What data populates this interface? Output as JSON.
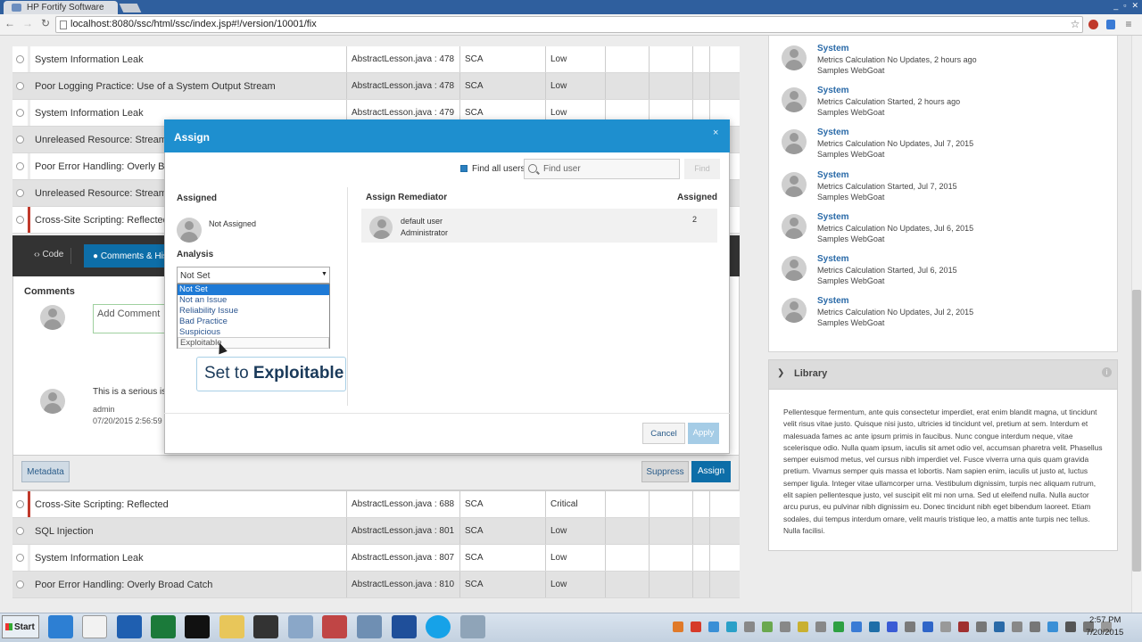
{
  "browser": {
    "tab_title": "HP Fortify Software",
    "url": "localhost:8080/ssc/html/ssc/index.jsp#!/version/10001/fix"
  },
  "issues_top": [
    {
      "category": "System Information Leak",
      "file": "AbstractLesson.java : 478",
      "analysis": "SCA",
      "severity": "Low",
      "sev_color": "#ececec"
    },
    {
      "category": "Poor Logging Practice: Use of a System Output Stream",
      "file": "AbstractLesson.java : 478",
      "analysis": "SCA",
      "severity": "Low",
      "sev_color": "#e2e2e2"
    },
    {
      "category": "System Information Leak",
      "file": "AbstractLesson.java : 479",
      "analysis": "SCA",
      "severity": "Low",
      "sev_color": "#ececec"
    },
    {
      "category": "Unreleased Resource: Streams",
      "file": "",
      "analysis": "",
      "severity": "",
      "sev_color": "#e2e2e2"
    },
    {
      "category": "Poor Error Handling: Overly Broad Catch",
      "file": "",
      "analysis": "",
      "severity": "",
      "sev_color": "#ececec"
    },
    {
      "category": "Unreleased Resource: Streams",
      "file": "",
      "analysis": "",
      "severity": "",
      "sev_color": "#e2e2e2"
    },
    {
      "category": "Cross-Site Scripting: Reflected",
      "file": "",
      "analysis": "",
      "severity": "",
      "sev_color": "#c0392b"
    }
  ],
  "issues_bottom": [
    {
      "category": "Cross-Site Scripting: Reflected",
      "file": "AbstractLesson.java : 688",
      "analysis": "SCA",
      "severity": "Critical",
      "sev_color": "#c0392b"
    },
    {
      "category": "SQL Injection",
      "file": "AbstractLesson.java : 801",
      "analysis": "SCA",
      "severity": "Low",
      "sev_color": "#e2e2e2"
    },
    {
      "category": "System Information Leak",
      "file": "AbstractLesson.java : 807",
      "analysis": "SCA",
      "severity": "Low",
      "sev_color": "#ececec"
    },
    {
      "category": "Poor Error Handling: Overly Broad Catch",
      "file": "AbstractLesson.java : 810",
      "analysis": "SCA",
      "severity": "Low",
      "sev_color": "#e2e2e2"
    }
  ],
  "detail": {
    "tab_code": "Code",
    "tab_comments": "Comments & Histo",
    "comments_title": "Comments",
    "add_comment": "Add Comment",
    "comment_text": "This is a serious issu",
    "comment_author": "admin",
    "comment_date": "07/20/2015 2:56:59",
    "metadata_btn": "Metadata",
    "suppress_btn": "Suppress",
    "assign_btn": "Assign"
  },
  "activity": [
    {
      "who": "System",
      "msg": "Metrics Calculation No Updates, 2 hours ago",
      "project": "Samples WebGoat"
    },
    {
      "who": "System",
      "msg": "Metrics Calculation Started, 2 hours ago",
      "project": "Samples WebGoat"
    },
    {
      "who": "System",
      "msg": "Metrics Calculation No Updates, Jul 7, 2015",
      "project": "Samples WebGoat"
    },
    {
      "who": "System",
      "msg": "Metrics Calculation Started, Jul 7, 2015",
      "project": "Samples WebGoat"
    },
    {
      "who": "System",
      "msg": "Metrics Calculation No Updates, Jul 6, 2015",
      "project": "Samples WebGoat"
    },
    {
      "who": "System",
      "msg": "Metrics Calculation Started, Jul 6, 2015",
      "project": "Samples WebGoat"
    },
    {
      "who": "System",
      "msg": "Metrics Calculation No Updates, Jul 2, 2015",
      "project": "Samples WebGoat"
    }
  ],
  "library": {
    "title": "Library",
    "text": "Pellentesque fermentum, ante quis consectetur imperdiet, erat enim blandit magna, ut tincidunt velit risus vitae justo. Quisque nisi justo, ultricies id tincidunt vel, pretium at sem. Interdum et malesuada fames ac ante ipsum primis in faucibus. Nunc congue interdum neque, vitae scelerisque odio. Nulla quam ipsum, iaculis sit amet odio vel, accumsan pharetra velit. Phasellus semper euismod metus, vel cursus nibh imperdiet vel. Fusce viverra urna quis quam gravida pretium. Vivamus semper quis massa et lobortis. Nam sapien enim, iaculis ut justo at, luctus semper ligula. Integer vitae ullamcorper urna. Vestibulum dignissim, turpis nec aliquam rutrum, elit sapien pellentesque justo, vel suscipit elit mi non urna. Sed ut eleifend nulla. Nulla auctor arcu purus, eu pulvinar nibh dignissim eu. Donec tincidunt nibh eget bibendum laoreet. Etiam sodales, dui tempus interdum ornare, velit mauris tristique leo, a mattis ante turpis nec tellus. Nulla facilisi."
  },
  "modal": {
    "title": "Assign",
    "close": "×",
    "find_all_users": "Find all users",
    "find_user_placeholder": "Find user",
    "find_btn": "Find",
    "assigned_label": "Assigned",
    "not_assigned": "Not Assigned",
    "analysis_label": "Analysis",
    "select_value": "Not Set",
    "options": [
      "Not Set",
      "Not an Issue",
      "Reliability Issue",
      "Bad Practice",
      "Suspicious",
      "Exploitable"
    ],
    "tooltip_prefix": "Set to ",
    "tooltip_value": "Exploitable",
    "remediator_label": "Assign Remediator",
    "assigned_col_label": "Assigned",
    "remediator_name": "default user",
    "remediator_role": "Administrator",
    "remediator_count": "2",
    "cancel_btn": "Cancel",
    "apply_btn": "Apply",
    "accent": "#1e8fcf"
  },
  "taskbar": {
    "start": "Start",
    "time": "2:57 PM",
    "date": "7/20/2015"
  }
}
